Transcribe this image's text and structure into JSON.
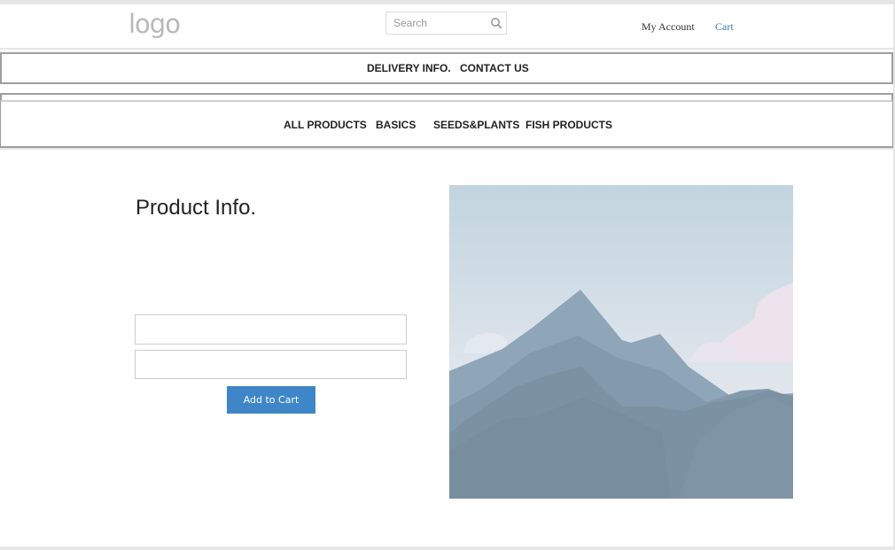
{
  "header": {
    "logo_text": "logo",
    "search": {
      "placeholder": "Search",
      "value": "",
      "icon": "search-icon"
    },
    "my_account_label": "My Account",
    "cart_label": "Cart"
  },
  "nav_primary": {
    "items": [
      {
        "label": "DELIVERY INFO."
      },
      {
        "label": "CONTACT US"
      }
    ]
  },
  "nav_categories": {
    "items": [
      {
        "label": "ALL PRODUCTS"
      },
      {
        "label": "BASICS"
      },
      {
        "label": "SEEDS&PLANTS"
      },
      {
        "label": "FISH PRODUCTS"
      }
    ]
  },
  "product": {
    "title": "Product Info.",
    "field_1_value": "",
    "field_2_value": "",
    "add_to_cart_label": "Add to Cart",
    "image": "mountain-landscape-placeholder"
  },
  "colors": {
    "accent": "#3f86c9",
    "cart_link": "#3a78b8",
    "nav_border": "#9e9e9e"
  }
}
